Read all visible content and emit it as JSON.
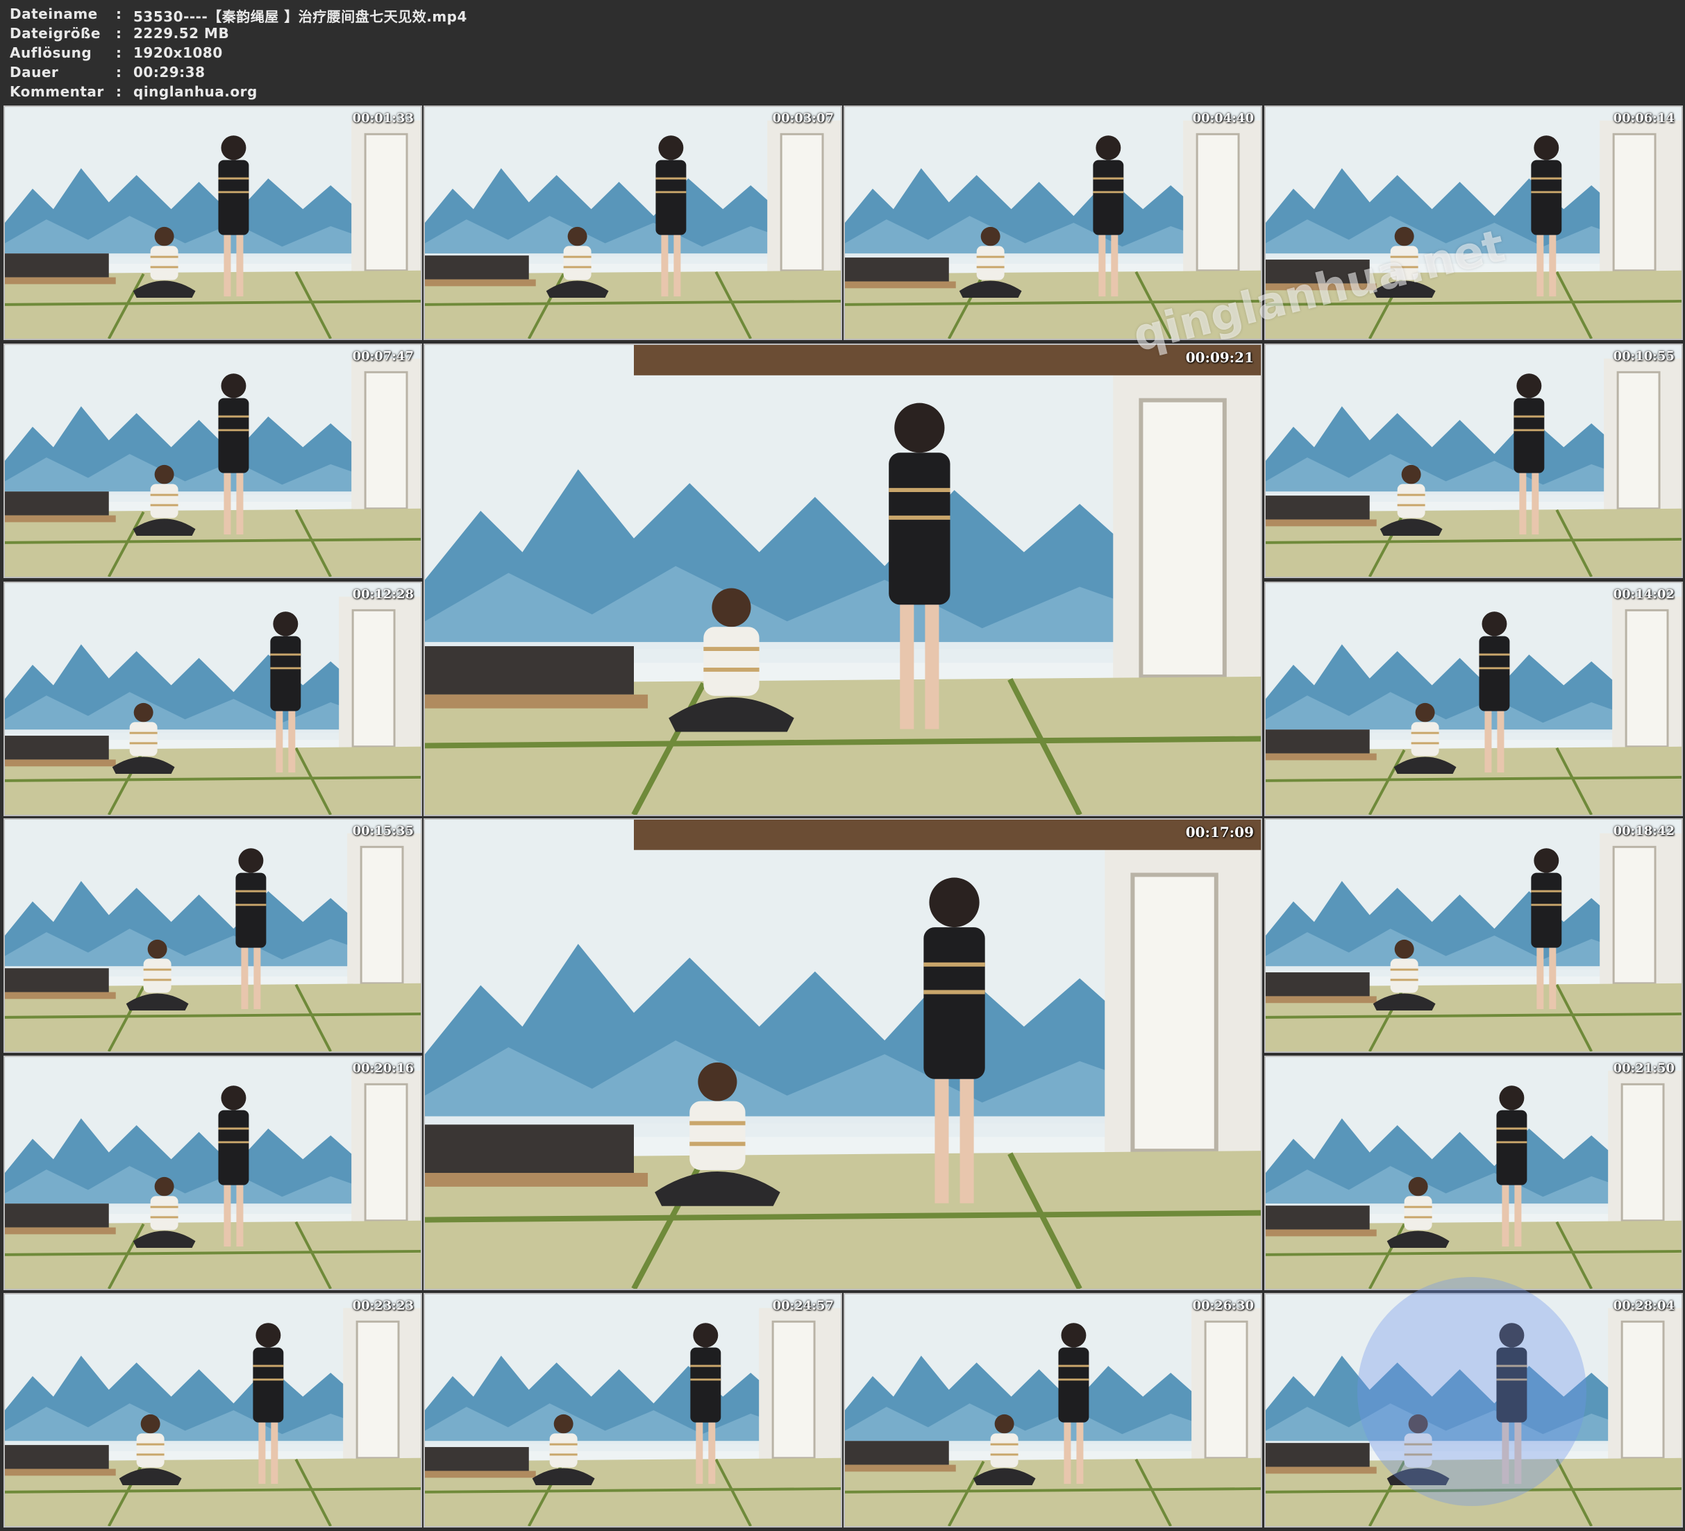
{
  "header": {
    "rows": [
      {
        "key": "Dateiname",
        "value": "53530----【秦韵绳屋 】治疗腰间盘七天见效.mp4"
      },
      {
        "key": "Dateigröße",
        "value": "2229.52 MB"
      },
      {
        "key": "Auflösung",
        "value": "1920x1080"
      },
      {
        "key": "Dauer",
        "value": "00:29:38"
      },
      {
        "key": "Kommentar",
        "value": "qinglanhua.org"
      }
    ],
    "separator": ":"
  },
  "watermark": "qinglanhua.net",
  "thumbnails": [
    {
      "time": "00:01:33"
    },
    {
      "time": "00:03:07"
    },
    {
      "time": "00:04:40"
    },
    {
      "time": "00:06:14"
    },
    {
      "time": "00:07:47"
    },
    {
      "time": "00:09:21"
    },
    {
      "time": "00:10:55"
    },
    {
      "time": "00:12:28"
    },
    {
      "time": "00:14:02"
    },
    {
      "time": "00:15:35"
    },
    {
      "time": "00:17:09"
    },
    {
      "time": "00:18:42"
    },
    {
      "time": "00:20:16"
    },
    {
      "time": "00:21:50"
    },
    {
      "time": "00:23:23"
    },
    {
      "time": "00:24:57"
    },
    {
      "time": "00:26:30"
    },
    {
      "time": "00:28:04"
    }
  ],
  "colors": {
    "background": "#2e2e2e",
    "wall_sky": "#e8eff1",
    "mountain": "#3f86b0",
    "tatami": "#c9c79a",
    "tatami_border": "#6f8a3a",
    "dark_clothing": "#1e1e20"
  }
}
